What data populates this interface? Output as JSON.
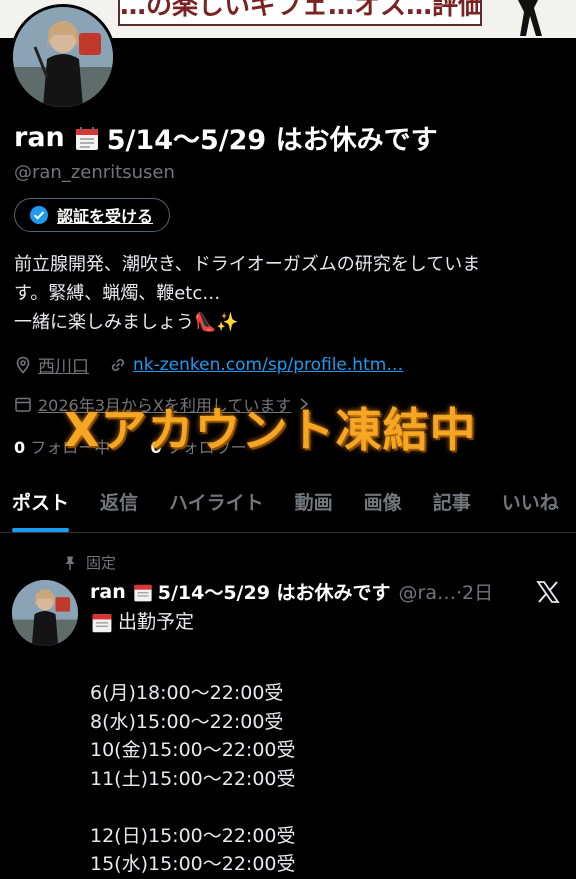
{
  "banner": {
    "text": "…の楽しいギフェ…オス…評価…"
  },
  "profile": {
    "name": "ran",
    "name_suffix": "5/14～5/29 はお休みです",
    "handle": "@ran_zenritsusen",
    "verify_label": "認証を受ける",
    "bio_line1": "前立腺開発、潮吹き、ドライオーガズムの研究をしていま",
    "bio_line2": "す。緊縛、蝋燭、鞭etc…",
    "bio_line3": "一緒に楽しみましょう",
    "bio_emoji": "👠✨",
    "location": "西川口",
    "link": "nk-zenken.com/sp/profile.htm…",
    "joined": "2026年3月からXを利用しています",
    "following_count": "0",
    "following_label": "フォロー中",
    "followers_count": "0",
    "followers_label": "フォロワー",
    "overlay": "Xアカウント凍結中"
  },
  "tabs": [
    "ポスト",
    "返信",
    "ハイライト",
    "動画",
    "画像",
    "記事",
    "いいね"
  ],
  "pinned_post": {
    "pinned_label": "固定",
    "author": "ran",
    "author_suffix": "5/14～5/29 はお休みです",
    "handle_time": "@ra…·2日",
    "title": "出勤予定",
    "schedule": "6(月)18:00～22:00受\n8(水)15:00～22:00受\n10(金)15:00～22:00受\n11(土)15:00～22:00受\n\n12(日)15:00～22:00受\n15(水)15:00～22:00受"
  },
  "colors": {
    "accent": "#1d9bf0",
    "overlay": "#f5a623",
    "muted": "#71767b",
    "background": "#000000"
  }
}
